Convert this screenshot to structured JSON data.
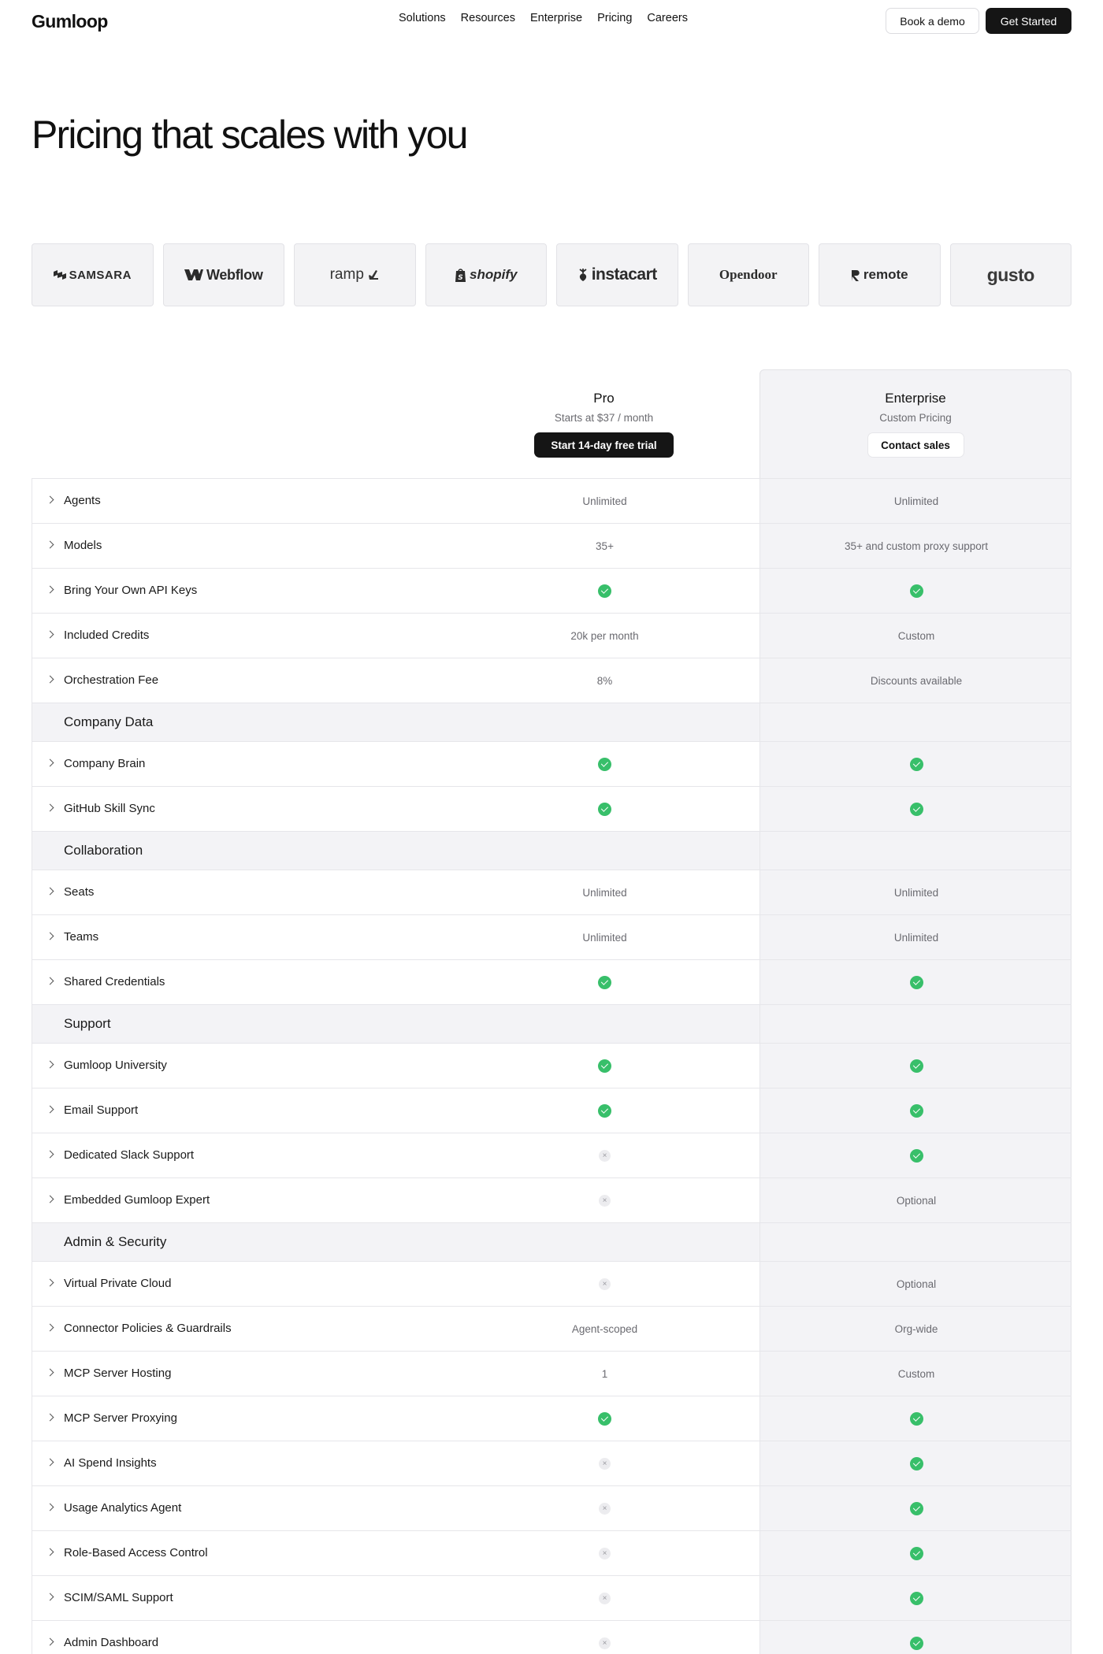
{
  "nav": {
    "logo": "Gumloop",
    "links": [
      "Solutions",
      "Resources",
      "Enterprise",
      "Pricing",
      "Careers"
    ],
    "book_demo": "Book a demo",
    "get_started": "Get Started"
  },
  "hero": {
    "title": "Pricing that scales with you"
  },
  "logos": [
    "SAMSARA",
    "Webflow",
    "ramp",
    "shopify",
    "instacart",
    "Opendoor",
    "remote",
    "gusto"
  ],
  "plans": {
    "pro": {
      "name": "Pro",
      "price": "Starts at $37 / month",
      "cta": "Start 14-day free trial"
    },
    "enterprise": {
      "name": "Enterprise",
      "price": "Custom Pricing",
      "cta": "Contact sales"
    }
  },
  "table": [
    {
      "type": "row",
      "label": "Agents",
      "pro": "Unlimited",
      "ent": "Unlimited"
    },
    {
      "type": "row",
      "label": "Models",
      "pro": "35+",
      "ent": "35+ and custom proxy support"
    },
    {
      "type": "row",
      "label": "Bring Your Own API Keys",
      "pro": "check",
      "ent": "check"
    },
    {
      "type": "row",
      "label": "Included Credits",
      "pro": "20k per month",
      "ent": "Custom"
    },
    {
      "type": "row",
      "label": "Orchestration Fee",
      "pro": "8%",
      "ent": "Discounts available"
    },
    {
      "type": "section",
      "label": "Company Data"
    },
    {
      "type": "row",
      "label": "Company Brain",
      "pro": "check",
      "ent": "check"
    },
    {
      "type": "row",
      "label": "GitHub Skill Sync",
      "pro": "check",
      "ent": "check"
    },
    {
      "type": "section",
      "label": "Collaboration"
    },
    {
      "type": "row",
      "label": "Seats",
      "pro": "Unlimited",
      "ent": "Unlimited"
    },
    {
      "type": "row",
      "label": "Teams",
      "pro": "Unlimited",
      "ent": "Unlimited"
    },
    {
      "type": "row",
      "label": "Shared Credentials",
      "pro": "check",
      "ent": "check"
    },
    {
      "type": "section",
      "label": "Support"
    },
    {
      "type": "row",
      "label": "Gumloop University",
      "pro": "check",
      "ent": "check"
    },
    {
      "type": "row",
      "label": "Email Support",
      "pro": "check",
      "ent": "check"
    },
    {
      "type": "row",
      "label": "Dedicated Slack Support",
      "pro": "cross",
      "ent": "check"
    },
    {
      "type": "row",
      "label": "Embedded Gumloop Expert",
      "pro": "cross",
      "ent": "Optional"
    },
    {
      "type": "section",
      "label": "Admin & Security"
    },
    {
      "type": "row",
      "label": "Virtual Private Cloud",
      "pro": "cross",
      "ent": "Optional"
    },
    {
      "type": "row",
      "label": "Connector Policies & Guardrails",
      "pro": "Agent-scoped",
      "ent": "Org-wide"
    },
    {
      "type": "row",
      "label": "MCP Server Hosting",
      "pro": "1",
      "ent": "Custom"
    },
    {
      "type": "row",
      "label": "MCP Server Proxying",
      "pro": "check",
      "ent": "check"
    },
    {
      "type": "row",
      "label": "AI Spend Insights",
      "pro": "cross",
      "ent": "check"
    },
    {
      "type": "row",
      "label": "Usage Analytics Agent",
      "pro": "cross",
      "ent": "check"
    },
    {
      "type": "row",
      "label": "Role-Based Access Control",
      "pro": "cross",
      "ent": "check"
    },
    {
      "type": "row",
      "label": "SCIM/SAML Support",
      "pro": "cross",
      "ent": "check"
    },
    {
      "type": "row",
      "label": "Admin Dashboard",
      "pro": "cross",
      "ent": "check"
    }
  ],
  "colors": {
    "check": "#38bf6a",
    "dark_button": "#151515",
    "enterprise_bg": "#f3f3f6"
  }
}
